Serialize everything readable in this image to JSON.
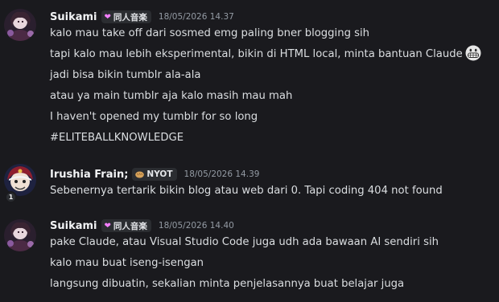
{
  "messages": [
    {
      "author": "Suikami",
      "tag": {
        "icon": "heart-icon",
        "text": "同人音楽",
        "color": "#f47fff"
      },
      "timestamp": "18/05/2026 14.37",
      "lines": [
        "kalo mau take off dari sosmed emg paling bner blogging sih",
        "tapi kalo mau lebih eksperimental, bikin di HTML local, minta bantuan Claude",
        "jadi bisa bikin tumblr ala-ala",
        "atau ya main tumblr aja kalo masih mau mah",
        "I haven't opened my tumblr for so long",
        "#ELITEBALLKNOWLEDGE"
      ],
      "line_emoji": "grinning-face-emoji"
    },
    {
      "author": "Irushia Frain;",
      "tag": {
        "icon": "bread-icon",
        "text": "NYOT"
      },
      "timestamp": "18/05/2026 14.39",
      "avatar_badge": "1",
      "lines": [
        "Sebenernya tertarik bikin blog atau web dari 0. Tapi coding 404 not found"
      ]
    },
    {
      "author": "Suikami",
      "tag": {
        "icon": "heart-icon",
        "text": "同人音楽",
        "color": "#f47fff"
      },
      "timestamp": "18/05/2026 14.40",
      "lines": [
        "pake Claude, atau Visual Studio Code juga udh ada bawaan AI sendiri sih",
        "kalo mau buat iseng-isengan",
        "langsung dibuatin, sekalian minta penjelasannya buat belajar juga"
      ]
    }
  ],
  "colors": {
    "background": "#1a1a1e",
    "text": "#dbdee1",
    "username": "#f2f3f5",
    "timestamp": "#949ba4",
    "tag_bg": "#2b2d31"
  }
}
